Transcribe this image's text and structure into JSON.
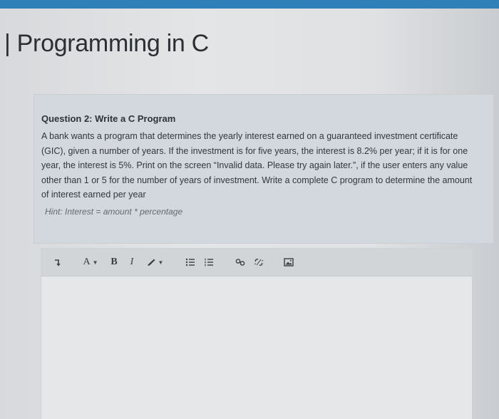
{
  "page": {
    "title": "| Programming in C"
  },
  "question": {
    "heading": "Question 2: Write a C Program",
    "body": "A bank wants a program that determines the yearly interest earned on a guaranteed investment certificate (GIC), given a number of years. If the investment is for five years, the interest is 8.2% per year; if it is for one year, the interest is 5%. Print on the screen “Invalid data. Please try again later.”, if the user enters any value other than 1 or 5 for the number of years of investment. Write a complete C program to determine the amount of interest earned per year",
    "hint": "Hint: Interest = amount * percentage"
  },
  "toolbar": {
    "font_label": "A",
    "bold_label": "B",
    "italic_label": "I"
  },
  "icons": {
    "undo": "undo-icon",
    "text_style": "font-style-icon",
    "highlighter": "highlighter-icon",
    "bullet_list": "bullet-list-icon",
    "numbered_list": "numbered-list-icon",
    "link": "link-icon",
    "unlink": "unlink-icon",
    "image": "image-icon"
  },
  "colors": {
    "top_bar": "#2f7fb8",
    "card_background": "#d2d8de",
    "toolbar_background": "#d2d5d8"
  }
}
